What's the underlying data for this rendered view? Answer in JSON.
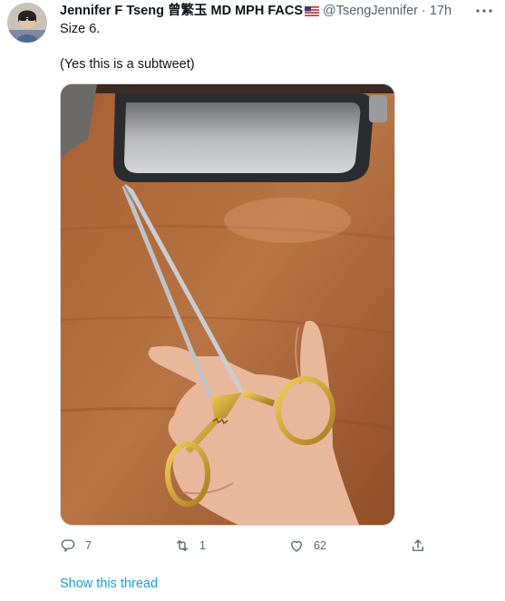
{
  "tweet": {
    "author": {
      "display_name": "Jennifer F Tseng 曾繁玉 MD MPH FACS",
      "handle": "@TsengJennifer",
      "separator": "·",
      "time": "17h"
    },
    "text_line1": "Size 6.",
    "text_line2": "(Yes this is a subtweet)",
    "actions": {
      "reply_count": "7",
      "retweet_count": "1",
      "like_count": "62"
    },
    "show_thread_label": "Show this thread"
  },
  "colors": {
    "secondary_text": "#536471",
    "link": "#1d9bf0",
    "primary_text": "#0f1419"
  },
  "icons": {
    "reply": "reply-icon",
    "retweet": "retweet-icon",
    "like": "heart-icon",
    "share": "share-icon",
    "more": "more-icon"
  }
}
